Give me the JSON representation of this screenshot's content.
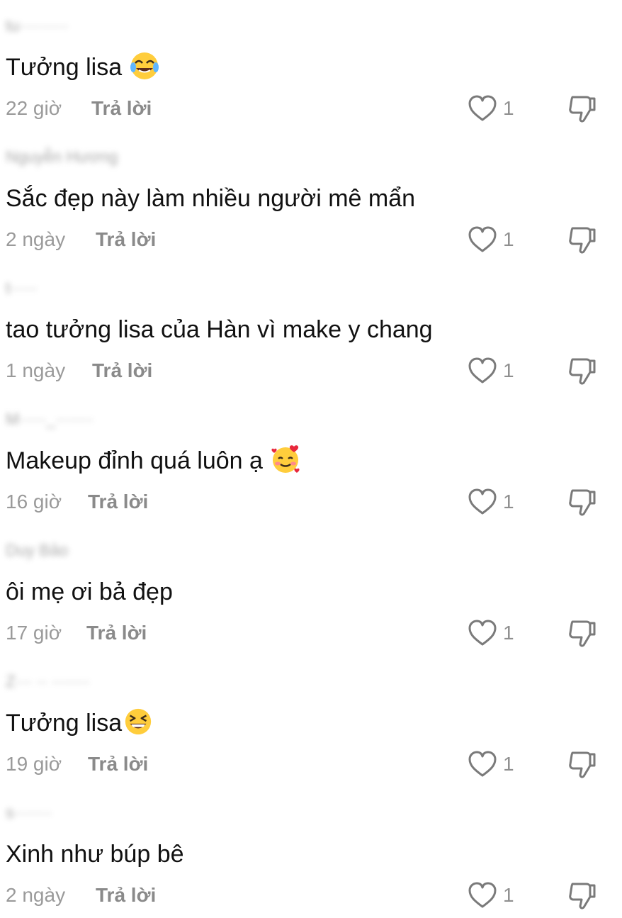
{
  "comments": [
    {
      "username": "tu·········",
      "text": "Tưởng lisa",
      "emoji": "laughing-tears-emoji",
      "time": "22 giờ",
      "reply_label": "Trả lời",
      "likes": "1"
    },
    {
      "username": "Nguyễn Hương",
      "text": "Sắc đẹp này làm nhiều người mê mẩn",
      "emoji": "",
      "time": "2 ngày",
      "reply_label": "Trả lời",
      "likes": "1"
    },
    {
      "username": "t·····",
      "text": "tao tưởng lisa của Hàn vì make y chang",
      "emoji": "",
      "time": "1 ngày",
      "reply_label": "Trả lời",
      "likes": "1"
    },
    {
      "username": "M·····_·······",
      "text": "Makeup đỉnh quá luôn ạ",
      "emoji": "smiling-hearts-emoji",
      "time": "16 giờ",
      "reply_label": "Trả lời",
      "likes": "1"
    },
    {
      "username": "Duy Bảo",
      "text": "ôi mẹ ơi bả đẹp",
      "emoji": "",
      "time": "17 giờ",
      "reply_label": "Trả lời",
      "likes": "1"
    },
    {
      "username": "Z··· ·· ·······",
      "text": "Tưởng lisa",
      "emoji": "grinning-squint-emoji",
      "time": "19 giờ",
      "reply_label": "Trả lời",
      "likes": "1"
    },
    {
      "username": "s·······",
      "text": "Xinh như búp bê",
      "emoji": "",
      "time": "2 ngày",
      "reply_label": "Trả lời",
      "likes": "1"
    }
  ],
  "icons": {
    "like": "heart-outline-icon",
    "dislike": "thumbs-down-outline-icon"
  },
  "colors": {
    "text": "#111111",
    "meta": "#9a9a9a",
    "icon": "#7a7a7a"
  }
}
